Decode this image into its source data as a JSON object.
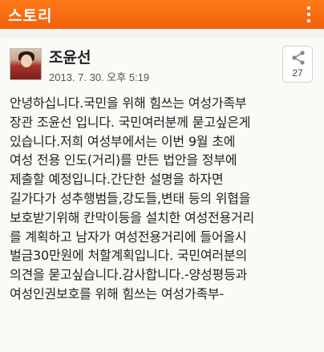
{
  "app_bar": {
    "title": "스토리",
    "menu_icon": "more-vert-icon"
  },
  "post": {
    "author": "조윤선",
    "date": "2013. 7. 30. 오후 5:19",
    "share": {
      "icon": "share-icon",
      "count": "27"
    },
    "lines": [
      "안녕하십니다.국민을 위해 힘쓰는 여성가족부",
      "장관 조윤선 입니다. 국민여러분께 묻고싶은게",
      "있습니다.저희 여성부에서는 이번 9월 초에",
      "여성 전용 인도(거리)를 만든 법안을 정부에",
      "제출할 예정입니다.간단한 설명을 하자면",
      "길가다가 성추행범들,강도들,변태 등의 위협을",
      "보호받기위해 칸막이등을 설치한 여성전용거리",
      "를 계획하고 남자가 여성전용거리에 들어올시",
      "벌금30만원에 처할계획입니다. 국민여러분의",
      "의견을 묻고싶습니다.감사합니다.-양성평등과",
      "여성인권보호를 위해 힘쓰는 여성가족부-"
    ]
  },
  "colors": {
    "app_bar": "#f2600b",
    "background": "#f4f2ee",
    "card": "#fbfaf7",
    "text": "#222222"
  }
}
